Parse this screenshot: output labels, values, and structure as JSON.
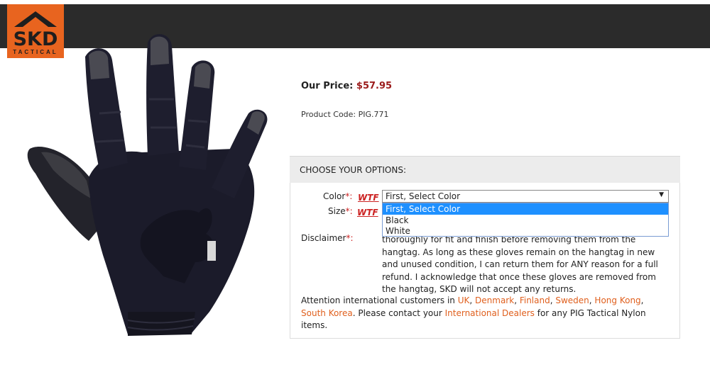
{
  "brand": {
    "logo_text": "SKD",
    "logo_subtext": "TACTICAL",
    "accent_color": "#e8641f",
    "topbar_color": "#2b2b2b"
  },
  "product": {
    "image_icon": "glove-image",
    "price_label": "Our Price:",
    "price_value": "$57.95",
    "code_label": "Product Code:",
    "code_value": "PIG.771"
  },
  "options": {
    "header": "CHOOSE YOUR OPTIONS:",
    "color_label": "Color",
    "size_label": "Size",
    "disclaimer_label": "Disclaimer",
    "required_mark": "*:",
    "wtf_link": "WTF",
    "select_value": "First, Select Color",
    "dropdown_items": [
      "First, Select Color",
      "Black",
      "White"
    ],
    "disclaimer_lines": [
      "thoroughly for fit and finish before removing them from the",
      "hangtag. As long as these gloves remain on the hangtag in new",
      "and unused condition, I can return them for ANY reason for a full",
      "refund. I acknowledge that once these gloves are removed from",
      "the hangtag, SKD will not accept any returns."
    ],
    "intl": {
      "prefix": "Attention international customers in ",
      "countries": [
        "UK",
        "Denmark",
        "Finland",
        "Sweden",
        "Hong Kong",
        "South Korea"
      ],
      "sep": ", ",
      "after_countries": ". Please contact your ",
      "dealers_link": "International Dealers",
      "suffix": " for any PIG Tactical Nylon items."
    }
  }
}
